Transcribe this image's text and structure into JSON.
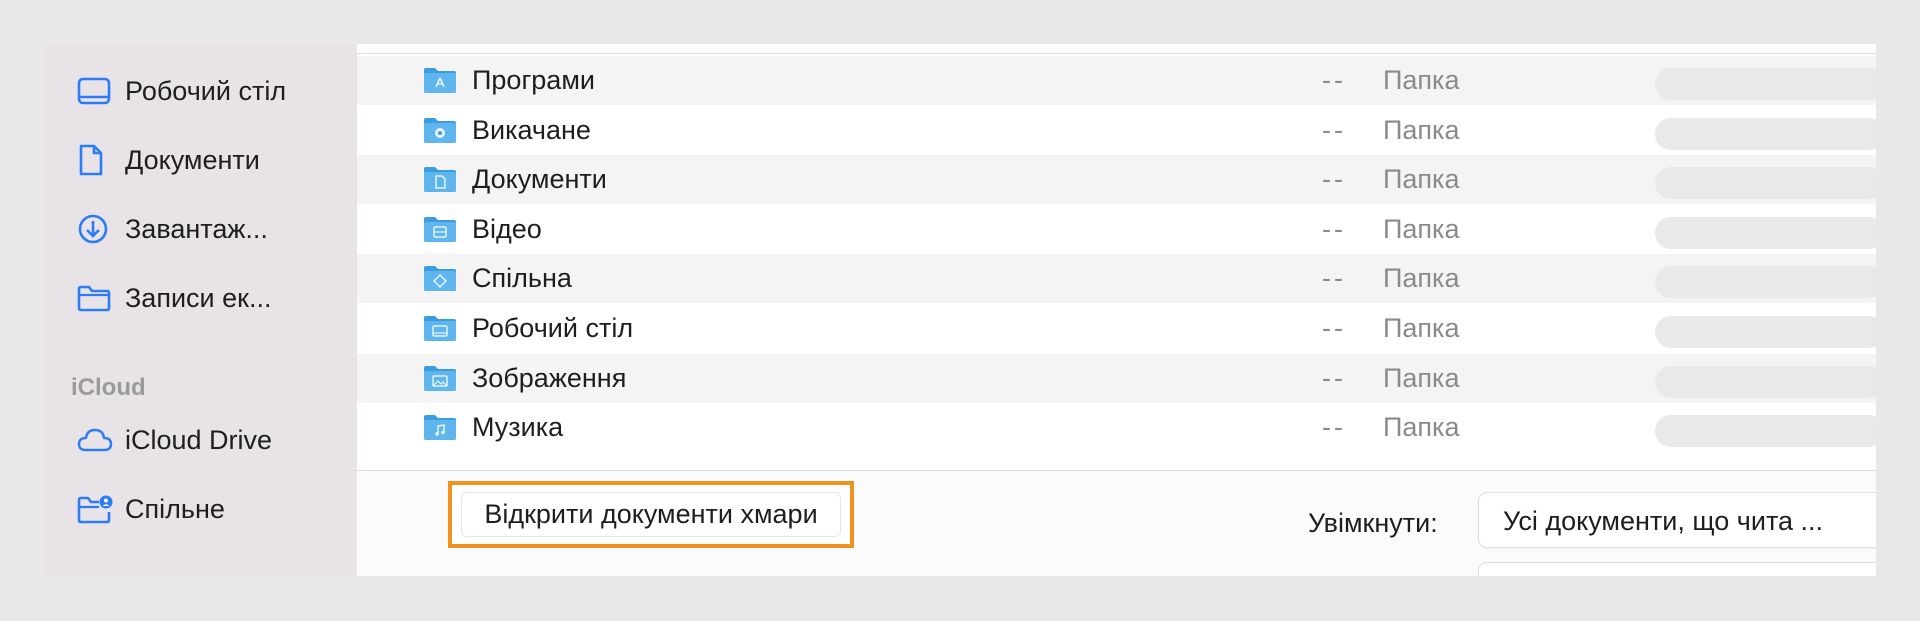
{
  "sidebar": {
    "items": [
      {
        "label": "Робочий стіл",
        "icon": "desktop-icon"
      },
      {
        "label": "Документи",
        "icon": "document-icon"
      },
      {
        "label": "Завантаж...",
        "icon": "download-icon"
      },
      {
        "label": "Записи ек...",
        "icon": "folder-icon"
      }
    ],
    "section_icloud": "iCloud",
    "icloud_items": [
      {
        "label": "iCloud Drive",
        "icon": "cloud-icon"
      },
      {
        "label": "Спільне",
        "icon": "shared-folder-icon"
      }
    ]
  },
  "files": [
    {
      "name": "Програми",
      "size": "--",
      "kind": "Папка",
      "icon": "applications-folder-icon"
    },
    {
      "name": "Викачане",
      "size": "--",
      "kind": "Папка",
      "icon": "downloads-folder-icon"
    },
    {
      "name": "Документи",
      "size": "--",
      "kind": "Папка",
      "icon": "documents-folder-icon"
    },
    {
      "name": "Відео",
      "size": "--",
      "kind": "Папка",
      "icon": "movies-folder-icon"
    },
    {
      "name": "Спільна",
      "size": "--",
      "kind": "Папка",
      "icon": "public-folder-icon"
    },
    {
      "name": "Робочий стіл",
      "size": "--",
      "kind": "Папка",
      "icon": "desktop-folder-icon"
    },
    {
      "name": "Зображення",
      "size": "--",
      "kind": "Папка",
      "icon": "pictures-folder-icon"
    },
    {
      "name": "Музика",
      "size": "--",
      "kind": "Папка",
      "icon": "music-folder-icon"
    }
  ],
  "bottom": {
    "open_cloud_button": "Відкрити документи хмари",
    "enable_label": "Увімкнути:",
    "enable_value": "Усі документи, що чита ..."
  },
  "colors": {
    "accent": "#2b7cf6",
    "highlight": "#f0931e",
    "folder": "#5fb6ef"
  }
}
